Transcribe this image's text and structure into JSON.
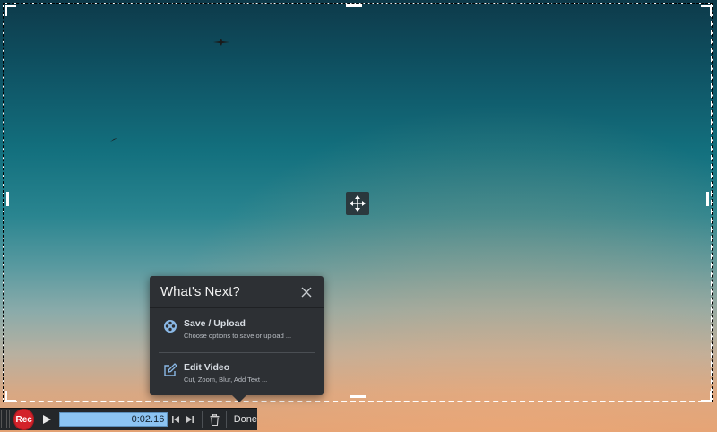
{
  "popup": {
    "title": "What's Next?",
    "options": [
      {
        "title": "Save / Upload",
        "subtitle": "Choose options to save or upload ..."
      },
      {
        "title": "Edit Video",
        "subtitle": "Cut, Zoom, Blur, Add Text ..."
      }
    ]
  },
  "toolbar": {
    "rec_label": "Rec",
    "timer": "0:02.16",
    "done_label": "Done"
  },
  "colors": {
    "rec": "#d3222a",
    "timer_bg": "#8cc4f2",
    "panel_bg": "#2d3034"
  }
}
